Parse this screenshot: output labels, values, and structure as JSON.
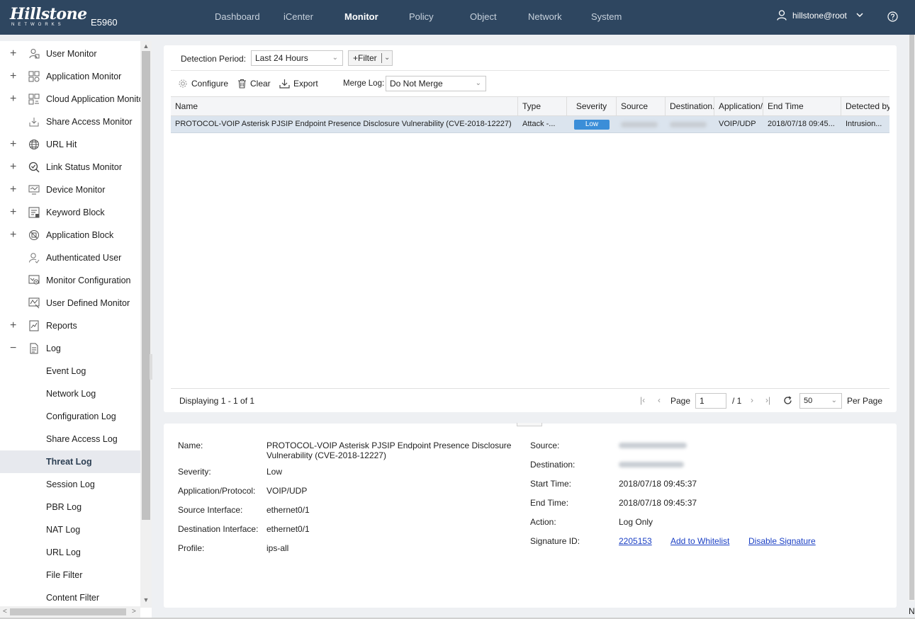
{
  "header": {
    "logo": "Hillstone",
    "logo_sub": "NETWORKS",
    "model": "E5960",
    "nav": [
      "Dashboard",
      "iCenter",
      "Monitor",
      "Policy",
      "Object",
      "Network",
      "System"
    ],
    "active_nav": "Monitor",
    "user": "hillstone@root"
  },
  "sidebar": {
    "items": [
      {
        "label": "User Monitor",
        "expand": "+",
        "icon": "user-monitor-icon"
      },
      {
        "label": "Application Monitor",
        "expand": "+",
        "icon": "application-monitor-icon"
      },
      {
        "label": "Cloud Application Monitor",
        "expand": "+",
        "icon": "cloud-application-icon"
      },
      {
        "label": "Share Access Monitor",
        "expand": "",
        "icon": "share-access-icon"
      },
      {
        "label": "URL Hit",
        "expand": "+",
        "icon": "globe-icon"
      },
      {
        "label": "Link Status Monitor",
        "expand": "+",
        "icon": "link-status-icon"
      },
      {
        "label": "Device Monitor",
        "expand": "+",
        "icon": "device-monitor-icon"
      },
      {
        "label": "Keyword Block",
        "expand": "+",
        "icon": "keyword-block-icon"
      },
      {
        "label": "Application Block",
        "expand": "+",
        "icon": "application-block-icon"
      },
      {
        "label": "Authenticated User",
        "expand": "",
        "icon": "authenticated-user-icon"
      },
      {
        "label": "Monitor Configuration",
        "expand": "",
        "icon": "monitor-configuration-icon"
      },
      {
        "label": "User Defined Monitor",
        "expand": "",
        "icon": "user-defined-monitor-icon"
      },
      {
        "label": "Reports",
        "expand": "+",
        "icon": "reports-icon"
      },
      {
        "label": "Log",
        "expand": "−",
        "icon": "log-icon"
      }
    ],
    "log_children": [
      "Event Log",
      "Network Log",
      "Configuration Log",
      "Share Access Log",
      "Threat Log",
      "Session Log",
      "PBR Log",
      "NAT Log",
      "URL Log",
      "File Filter",
      "Content Filter"
    ],
    "active_child": "Threat Log"
  },
  "filters": {
    "detection_period_label": "Detection Period:",
    "detection_period_value": "Last 24 Hours",
    "filter_button": "+Filter",
    "merge_log_label": "Merge Log:",
    "merge_log_value": "Do Not Merge"
  },
  "toolbar": {
    "configure": "Configure",
    "clear": "Clear",
    "export": "Export"
  },
  "table": {
    "columns": [
      "Name",
      "Type",
      "Severity",
      "Source",
      "Destination...",
      "Application/...",
      "End Time",
      "Detected by"
    ],
    "rows": [
      {
        "name": "PROTOCOL-VOIP Asterisk PJSIP Endpoint Presence Disclosure Vulnerability (CVE-2018-12227)",
        "type": "Attack -...",
        "severity": "Low",
        "application": "VOIP/UDP",
        "end_time": "2018/07/18 09:45...",
        "detected_by": "Intrusion..."
      }
    ]
  },
  "pager": {
    "displaying": "Displaying 1 - 1 of 1",
    "page_label": "Page",
    "page_value": "1",
    "total": "/ 1",
    "per_page_value": "50",
    "per_page_label": "Per Page"
  },
  "detail": {
    "name_label": "Name:",
    "name_value_line1": "PROTOCOL-VOIP Asterisk PJSIP Endpoint Presence Disclosure",
    "name_value_line2": "Vulnerability (CVE-2018-12227)",
    "severity_label": "Severity:",
    "severity_value": "Low",
    "app_label": "Application/Protocol:",
    "app_value": "VOIP/UDP",
    "src_if_label": "Source Interface:",
    "src_if_value": "ethernet0/1",
    "dst_if_label": "Destination Interface:",
    "dst_if_value": "ethernet0/1",
    "profile_label": "Profile:",
    "profile_value": "ips-all",
    "source_label": "Source:",
    "destination_label": "Destination:",
    "start_label": "Start Time:",
    "start_value": "2018/07/18 09:45:37",
    "end_label": "End Time:",
    "end_value": "2018/07/18 09:45:37",
    "action_label": "Action:",
    "action_value": "Log Only",
    "sig_label": "Signature ID:",
    "sig_value": "2205153",
    "whitelist_link": "Add to Whitelist",
    "disable_link": "Disable Signature"
  },
  "corner_text": "N"
}
